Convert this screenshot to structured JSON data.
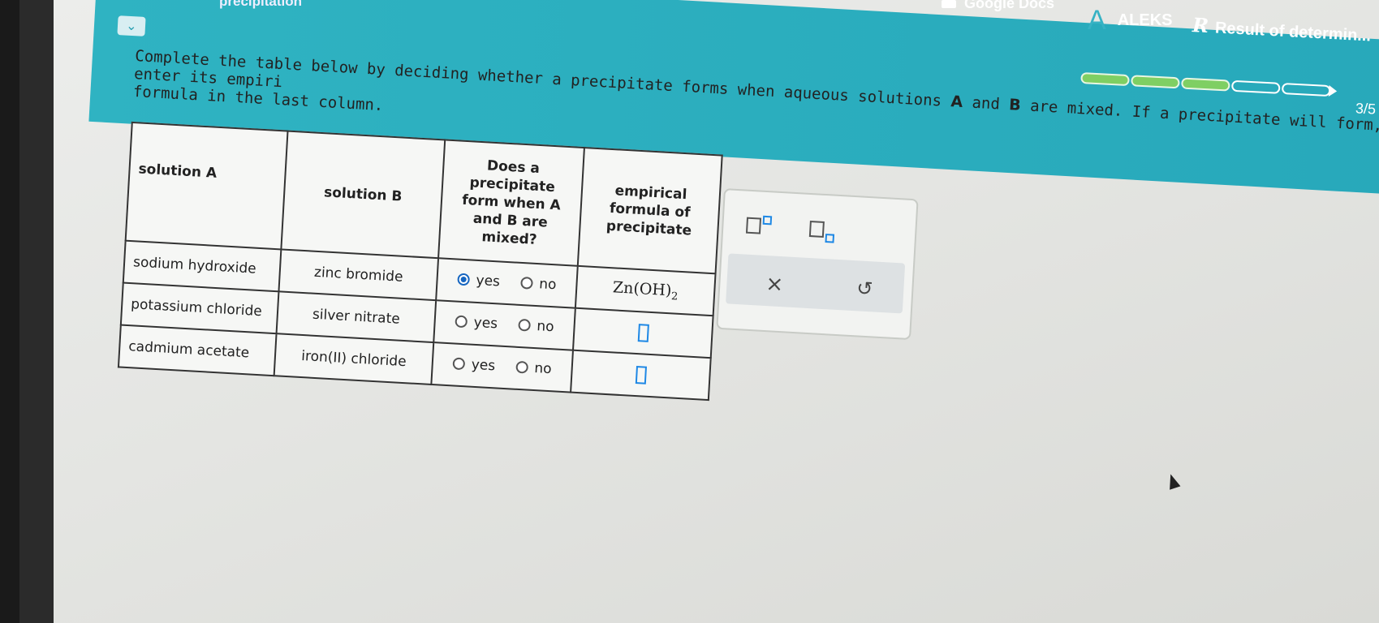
{
  "browser": {
    "tabs": [
      {
        "label": "precipitation"
      },
      {
        "label": "Google Docs"
      },
      {
        "label": "ALEKS",
        "icon": "aleks-a-icon"
      },
      {
        "label": "Result of determin...",
        "icon": "r-logo-icon"
      }
    ]
  },
  "header": {
    "collapse_icon": "chevron-down-icon",
    "progress": {
      "filled": 3,
      "total": 5,
      "label": "3/5"
    }
  },
  "question": {
    "instruction_1": "Complete the table below by deciding whether a precipitate forms when aqueous solutions ",
    "bold_a": "A",
    "and": " and ",
    "bold_b": "B",
    "instruction_2": " are mixed. If a precipitate will form, enter its empiri",
    "instruction_3": "formula in the last column."
  },
  "table": {
    "headers": {
      "solution_a": "solution A",
      "solution_b": "solution B",
      "precipitate_forms": "Does a precipitate form when A and B are mixed?",
      "empirical_formula": "empirical formula of precipitate"
    },
    "rows": [
      {
        "solution_a": "sodium hydroxide",
        "solution_b": "zinc bromide",
        "yes": "yes",
        "no": "no",
        "selected": "yes",
        "formula_base": "Zn(OH)",
        "formula_sub": "2"
      },
      {
        "solution_a": "potassium chloride",
        "solution_b": "silver nitrate",
        "yes": "yes",
        "no": "no",
        "selected": null,
        "formula_base": "",
        "formula_sub": ""
      },
      {
        "solution_a": "cadmium acetate",
        "solution_b": "iron(II) chloride",
        "yes": "yes",
        "no": "no",
        "selected": null,
        "formula_base": "",
        "formula_sub": ""
      }
    ]
  },
  "palette": {
    "superscript_icon": "superscript-template-icon",
    "subscript_icon": "subscript-template-icon",
    "clear_label": "×",
    "undo_label": "↺"
  },
  "colors": {
    "header_teal": "#2fb3c2",
    "progress_green": "#7fcf63",
    "radio_selected": "#1565c0",
    "input_blue": "#1e88e5"
  }
}
